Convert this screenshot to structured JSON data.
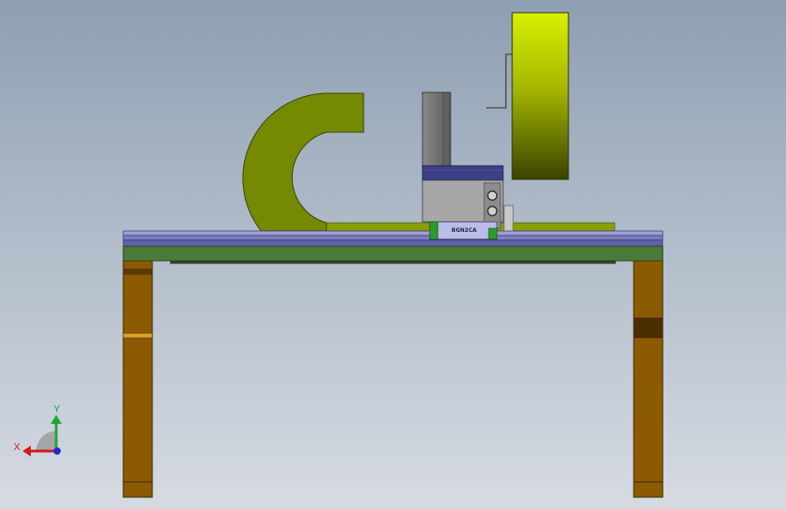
{
  "scene": {
    "part_label": "BGN2CA",
    "colors": {
      "background_top": "#8e9fb2",
      "background_bottom": "#d6dbe2",
      "leg": "#8c5a00",
      "leg_edge": "#3b2a08",
      "bed_rail": "#7d7fc0",
      "bed_base": "#4d7a3a",
      "c_frame": "#758a00",
      "carriage_body": "#a7a7a7",
      "carriage_top": "#3d3f87",
      "column": "#6c6c6c",
      "wheel_light": "#d8f000",
      "wheel_dark": "#3a4300",
      "rail_block": "#2c9a2c"
    }
  },
  "triad": {
    "x_label": "X",
    "y_label": "Y",
    "x_color": "#d21b1b",
    "y_color": "#1ea63a",
    "z_color": "#1d2ad6"
  }
}
